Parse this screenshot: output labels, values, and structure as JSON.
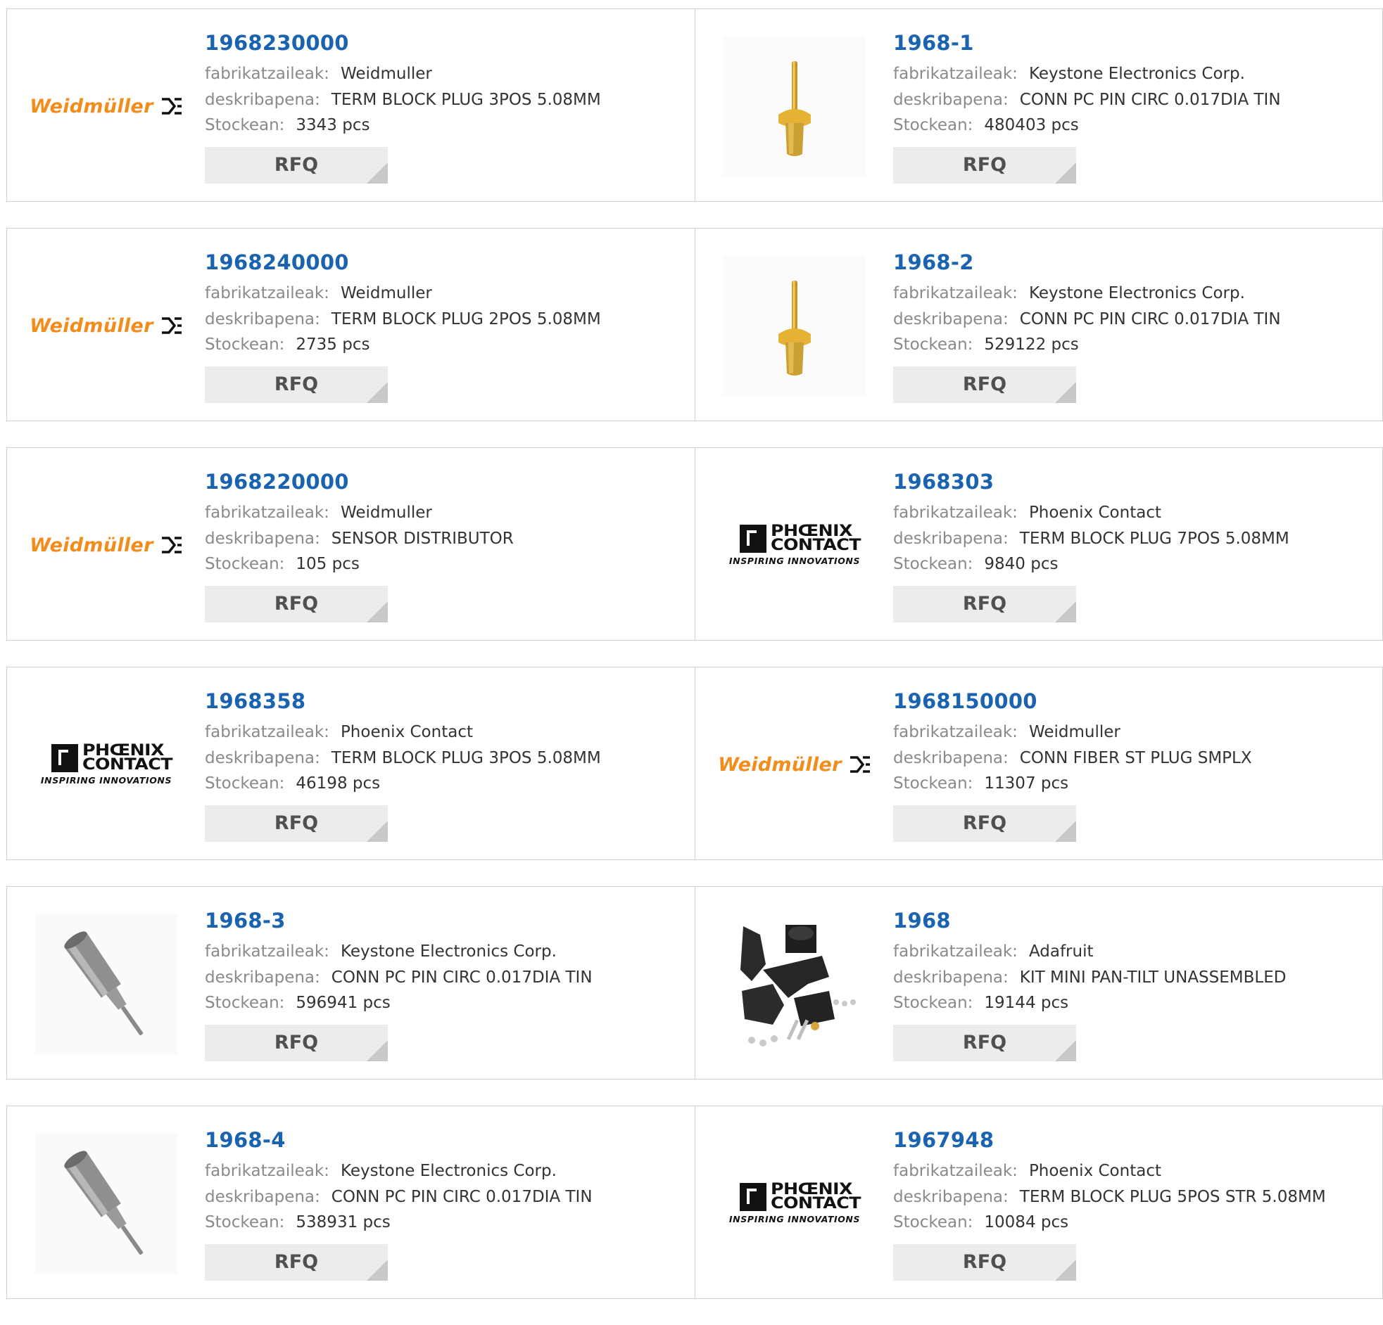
{
  "labels": {
    "manufacturer": "fabrikatzaileak:",
    "description": "deskribapena:",
    "stock": "Stockean:",
    "rfq": "RFQ"
  },
  "colors": {
    "part_link": "#1a63b0",
    "weidmuller_orange": "#f28c1a",
    "pin_gold": "#e0ad2c",
    "pin_gray": "#8c8c8c"
  },
  "logos": {
    "weidmuller": "Weidmüller",
    "phoenix_line1": "PHŒNIX",
    "phoenix_line2": "CONTACT",
    "phoenix_tagline": "INSPIRING INNOVATIONS"
  },
  "products": [
    {
      "image": "weidmuller-logo",
      "part": "1968230000",
      "manufacturer": "Weidmuller",
      "description": "TERM BLOCK PLUG 3POS 5.08MM",
      "stock": "3343 pcs"
    },
    {
      "image": "gold-pin",
      "part": "1968-1",
      "manufacturer": "Keystone Electronics Corp.",
      "description": "CONN PC PIN CIRC 0.017DIA TIN",
      "stock": "480403 pcs"
    },
    {
      "image": "weidmuller-logo",
      "part": "1968240000",
      "manufacturer": "Weidmuller",
      "description": "TERM BLOCK PLUG 2POS 5.08MM",
      "stock": "2735 pcs"
    },
    {
      "image": "gold-pin",
      "part": "1968-2",
      "manufacturer": "Keystone Electronics Corp.",
      "description": "CONN PC PIN CIRC 0.017DIA TIN",
      "stock": "529122 pcs"
    },
    {
      "image": "weidmuller-logo",
      "part": "1968220000",
      "manufacturer": "Weidmuller",
      "description": "SENSOR DISTRIBUTOR",
      "stock": "105 pcs"
    },
    {
      "image": "phoenix-logo",
      "part": "1968303",
      "manufacturer": "Phoenix Contact",
      "description": "TERM BLOCK PLUG 7POS 5.08MM",
      "stock": "9840 pcs"
    },
    {
      "image": "phoenix-logo",
      "part": "1968358",
      "manufacturer": "Phoenix Contact",
      "description": "TERM BLOCK PLUG 3POS 5.08MM",
      "stock": "46198 pcs"
    },
    {
      "image": "weidmuller-logo",
      "part": "1968150000",
      "manufacturer": "Weidmuller",
      "description": "CONN FIBER ST PLUG SMPLX",
      "stock": "11307 pcs"
    },
    {
      "image": "gray-pin",
      "part": "1968-3",
      "manufacturer": "Keystone Electronics Corp.",
      "description": "CONN PC PIN CIRC 0.017DIA TIN",
      "stock": "596941 pcs"
    },
    {
      "image": "pan-tilt-kit",
      "part": "1968",
      "manufacturer": "Adafruit",
      "description": "KIT MINI PAN-TILT UNASSEMBLED",
      "stock": "19144 pcs"
    },
    {
      "image": "gray-pin",
      "part": "1968-4",
      "manufacturer": "Keystone Electronics Corp.",
      "description": "CONN PC PIN CIRC 0.017DIA TIN",
      "stock": "538931 pcs"
    },
    {
      "image": "phoenix-logo",
      "part": "1967948",
      "manufacturer": "Phoenix Contact",
      "description": "TERM BLOCK PLUG 5POS STR 5.08MM",
      "stock": "10084 pcs"
    }
  ]
}
